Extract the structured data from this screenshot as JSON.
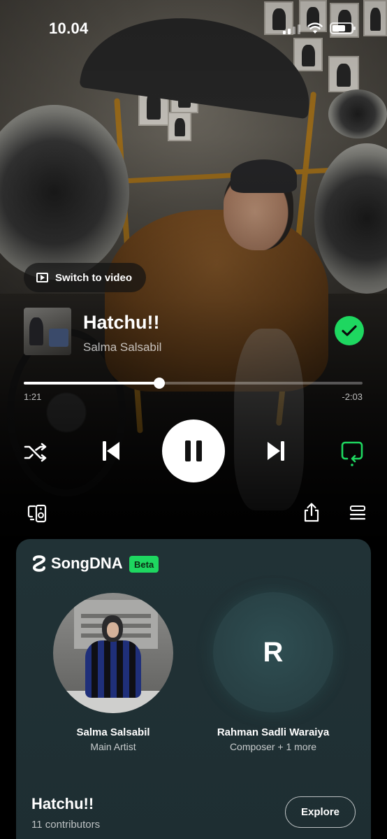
{
  "status_bar": {
    "time": "10.04"
  },
  "player": {
    "switch_video_label": "Switch to video",
    "track_title": "Hatchu!!",
    "artist": "Salma Salsabil",
    "liked": true,
    "progress": {
      "elapsed": "1:21",
      "remaining": "-2:03",
      "fraction": 0.4
    },
    "controls": {
      "shuffle": "shuffle-icon",
      "previous": "skip-previous-icon",
      "play_pause": "pause-icon",
      "next": "skip-next-icon",
      "repeat": "repeat-icon"
    },
    "accent": "#1ed760"
  },
  "songdna": {
    "logo_text": "SongDNA",
    "badge": "Beta",
    "people": [
      {
        "name": "Salma Salsabil",
        "role": "Main Artist"
      },
      {
        "name": "Rahman Sadli Waraiya",
        "role": "Composer + 1 more",
        "initial": "R"
      }
    ],
    "song_title": "Hatchu!!",
    "contributors": "11 contributors",
    "explore_label": "Explore"
  }
}
